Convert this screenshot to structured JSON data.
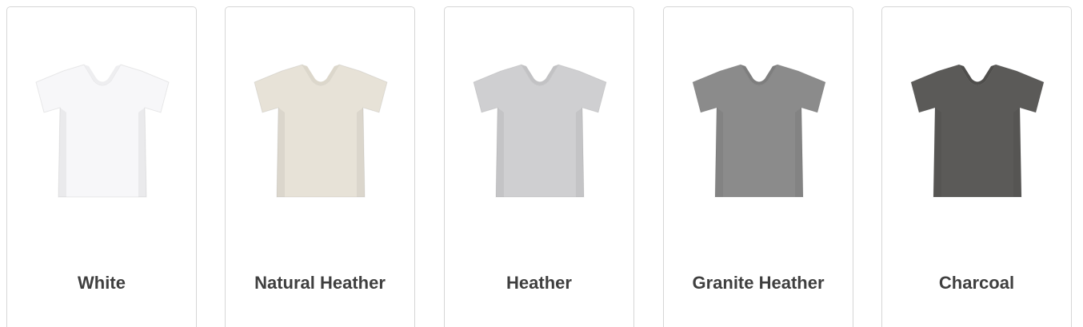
{
  "swatches": [
    {
      "label": "White",
      "color": "#f7f7f9",
      "neck": "#eeeef0"
    },
    {
      "label": "Natural Heather",
      "color": "#e7e2d7",
      "neck": "#dcd7cb"
    },
    {
      "label": "Heather",
      "color": "#cfcfd1",
      "neck": "#c2c2c4"
    },
    {
      "label": "Granite Heather",
      "color": "#8b8b8b",
      "neck": "#7e7e7e"
    },
    {
      "label": "Charcoal",
      "color": "#5b5a58",
      "neck": "#4f4e4c"
    }
  ]
}
